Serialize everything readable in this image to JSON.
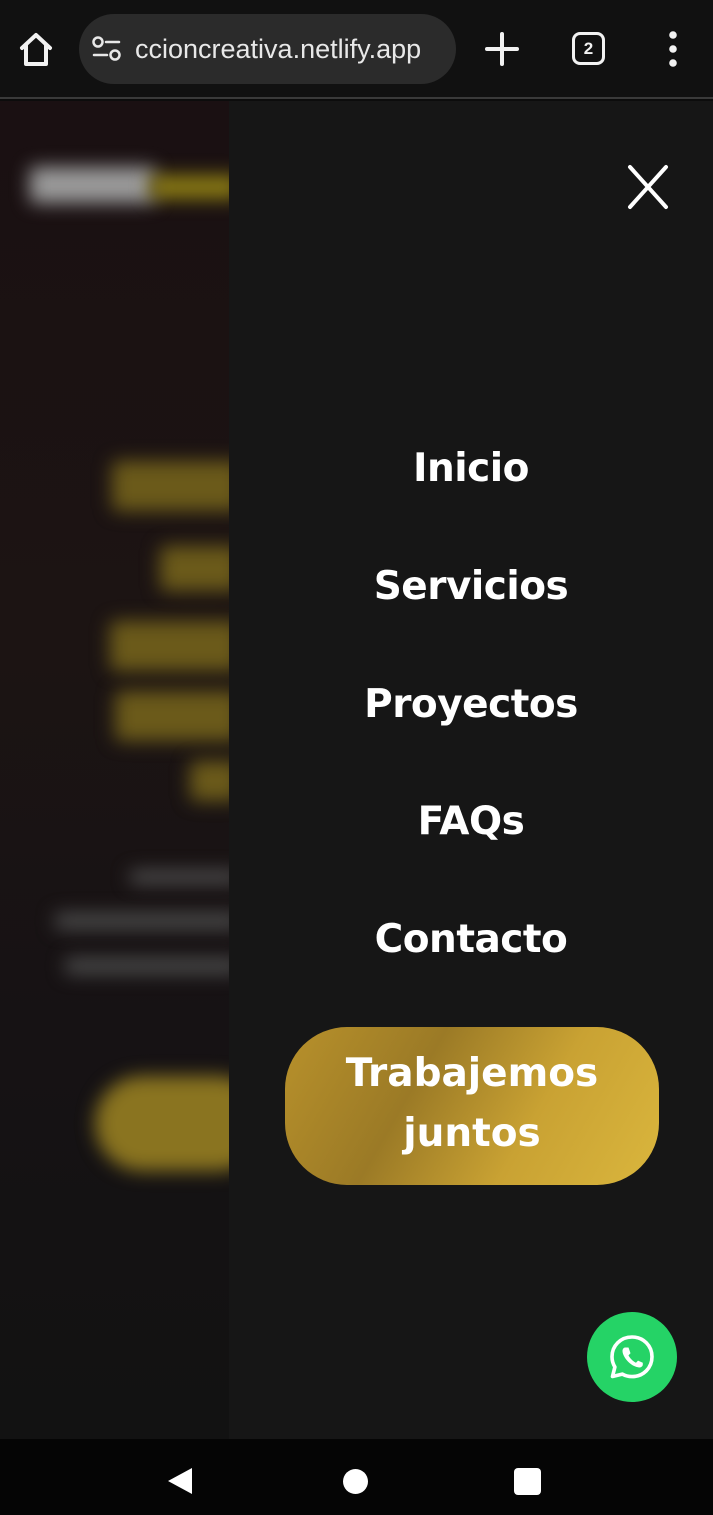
{
  "browser": {
    "url": "ccioncreativa.netlify.app",
    "tab_count": "2",
    "icons": [
      "home-icon",
      "site-settings-icon",
      "new-tab-icon",
      "tab-switcher-icon",
      "more-options-icon"
    ]
  },
  "menu": {
    "items": [
      {
        "label": "Inicio"
      },
      {
        "label": "Servicios"
      },
      {
        "label": "Proyectos"
      },
      {
        "label": "FAQs"
      },
      {
        "label": "Contacto"
      }
    ],
    "cta": {
      "line1": "Trabajemos",
      "line2": "juntos"
    },
    "icons": [
      "close-icon",
      "whatsapp-icon"
    ]
  },
  "colors": {
    "panel": "#161616",
    "cta_gold": "#c9a233",
    "whatsapp_green": "#25d366",
    "text": "#ffffff"
  },
  "system_nav": {
    "icons": [
      "back-icon",
      "home-circle-icon",
      "recents-icon"
    ]
  }
}
